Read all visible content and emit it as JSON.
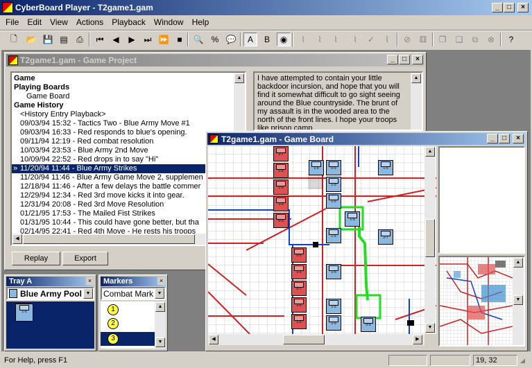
{
  "app": {
    "title": "CyberBoard Player - T2game1.gam"
  },
  "menu": [
    "File",
    "Edit",
    "View",
    "Actions",
    "Playback",
    "Window",
    "Help"
  ],
  "project": {
    "title": "T2game1.gam - Game Project",
    "tree": [
      {
        "text": "Game",
        "bold": true,
        "indent": 0
      },
      {
        "text": "Playing Boards",
        "bold": true,
        "indent": 0
      },
      {
        "text": "Game Board",
        "bold": false,
        "indent": 2
      },
      {
        "text": "Game History",
        "bold": true,
        "indent": 0
      },
      {
        "text": "<History Entry Playback>",
        "bold": false,
        "indent": 1
      },
      {
        "text": "09/03/94 15:32 - Tactics Two - Blue Army Move #1",
        "bold": false,
        "indent": 1
      },
      {
        "text": "09/03/94 16:33 - Red responds to blue's opening.",
        "bold": false,
        "indent": 1
      },
      {
        "text": "09/11/94 12:19 - Red combat resolution",
        "bold": false,
        "indent": 1
      },
      {
        "text": "10/03/94 23:53 - Blue Army 2nd Move",
        "bold": false,
        "indent": 1
      },
      {
        "text": "10/09/94 22:52 - Red drops in to say \"Hi\"",
        "bold": false,
        "indent": 1
      },
      {
        "text": "11/20/94 11:44 - Blue Army Strikes",
        "bold": false,
        "indent": 1,
        "selected": true,
        "marker": "»"
      },
      {
        "text": "11/20/94 11:46 - Blue Army Game Move 2, supplemen",
        "bold": false,
        "indent": 1
      },
      {
        "text": "12/18/94 11:46 - After a few delays the battle commer",
        "bold": false,
        "indent": 1
      },
      {
        "text": "12/29/94 12:34 - Red 3rd move kicks it into gear.",
        "bold": false,
        "indent": 1
      },
      {
        "text": "12/31/94 20:08 - Red 3rd Move Resolution",
        "bold": false,
        "indent": 1
      },
      {
        "text": "01/21/95 17:53 - The Mailed Fist Strikes",
        "bold": false,
        "indent": 1
      },
      {
        "text": "01/31/95 10:44 - This could have gone better, but tha",
        "bold": false,
        "indent": 1
      },
      {
        "text": "02/14/95 22:41 - Red 4th Move - He rests his troops",
        "bold": false,
        "indent": 1
      }
    ],
    "message": "I have attempted to contain your little backdoor incursion, and hope that you will find it somewhat difficult to go sight seeing around the Blue countryside.  The brunt of my assault is in the wooded area to the north of the front lines.  I hope your troops like prison camp",
    "replay_label": "Replay",
    "export_label": "Export"
  },
  "tray": {
    "title": "Tray A",
    "selected": "Blue Army Pool"
  },
  "markers": {
    "title": "Markers",
    "selected": "Combat Mark",
    "items": [
      "1",
      "2",
      "3"
    ]
  },
  "board": {
    "title": "T2game1.gam - Game Board"
  },
  "status": {
    "help": "For Help, press F1",
    "coords": "19, 32"
  },
  "colors": {
    "red_unit": "#e05050",
    "blue_unit": "#8ab8e0",
    "accent": "#0a246a",
    "move_path": "#22dd22"
  }
}
